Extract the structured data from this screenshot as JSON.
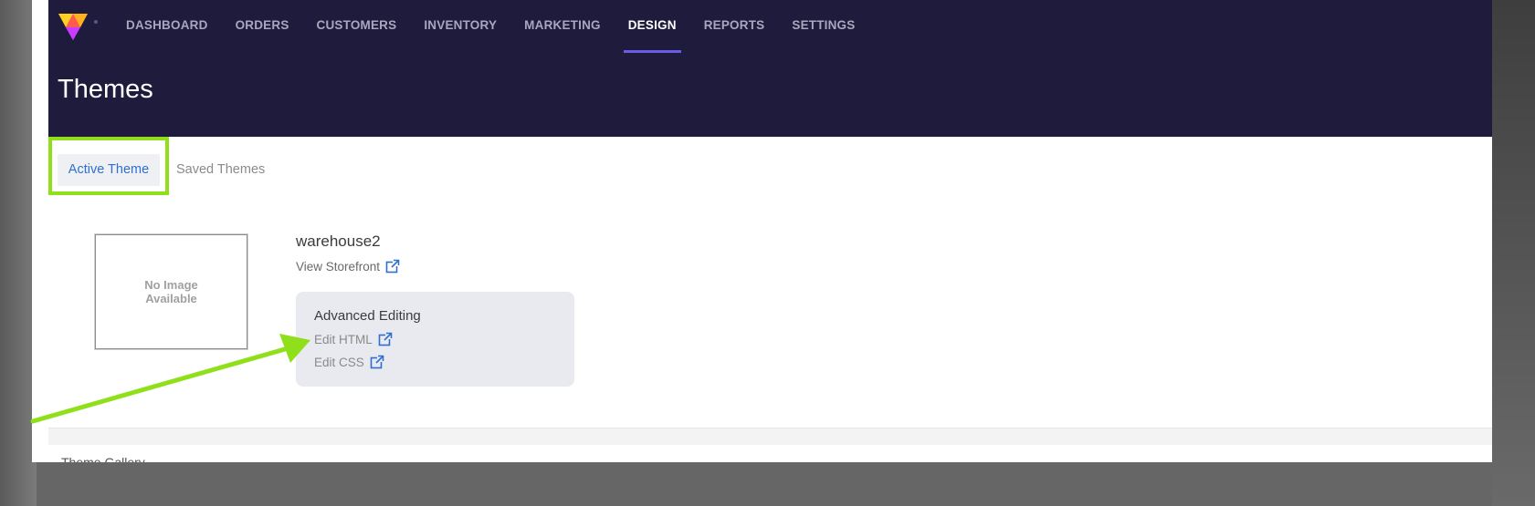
{
  "nav": {
    "items": [
      {
        "label": "DASHBOARD"
      },
      {
        "label": "ORDERS"
      },
      {
        "label": "CUSTOMERS"
      },
      {
        "label": "INVENTORY"
      },
      {
        "label": "MARKETING"
      },
      {
        "label": "DESIGN"
      },
      {
        "label": "REPORTS"
      },
      {
        "label": "SETTINGS"
      }
    ],
    "active": "DESIGN",
    "active_underline_color": "#6b5ce7"
  },
  "header": {
    "title": "Themes",
    "background_color": "#1f1b3d"
  },
  "tabs": {
    "active_label": "Active Theme",
    "saved_label": "Saved Themes",
    "highlight_color": "#8fe01a"
  },
  "theme": {
    "thumbnail_text": "No Image Available",
    "name": "warehouse2",
    "view_storefront_label": "View Storefront"
  },
  "advanced_editing": {
    "title": "Advanced Editing",
    "edit_html_label": "Edit HTML",
    "edit_css_label": "Edit CSS"
  },
  "gallery": {
    "label": "Theme Gallery"
  },
  "icons": {
    "logo": "logo-icon",
    "external": "external-link-icon",
    "annotation": "arrow-annotation"
  }
}
